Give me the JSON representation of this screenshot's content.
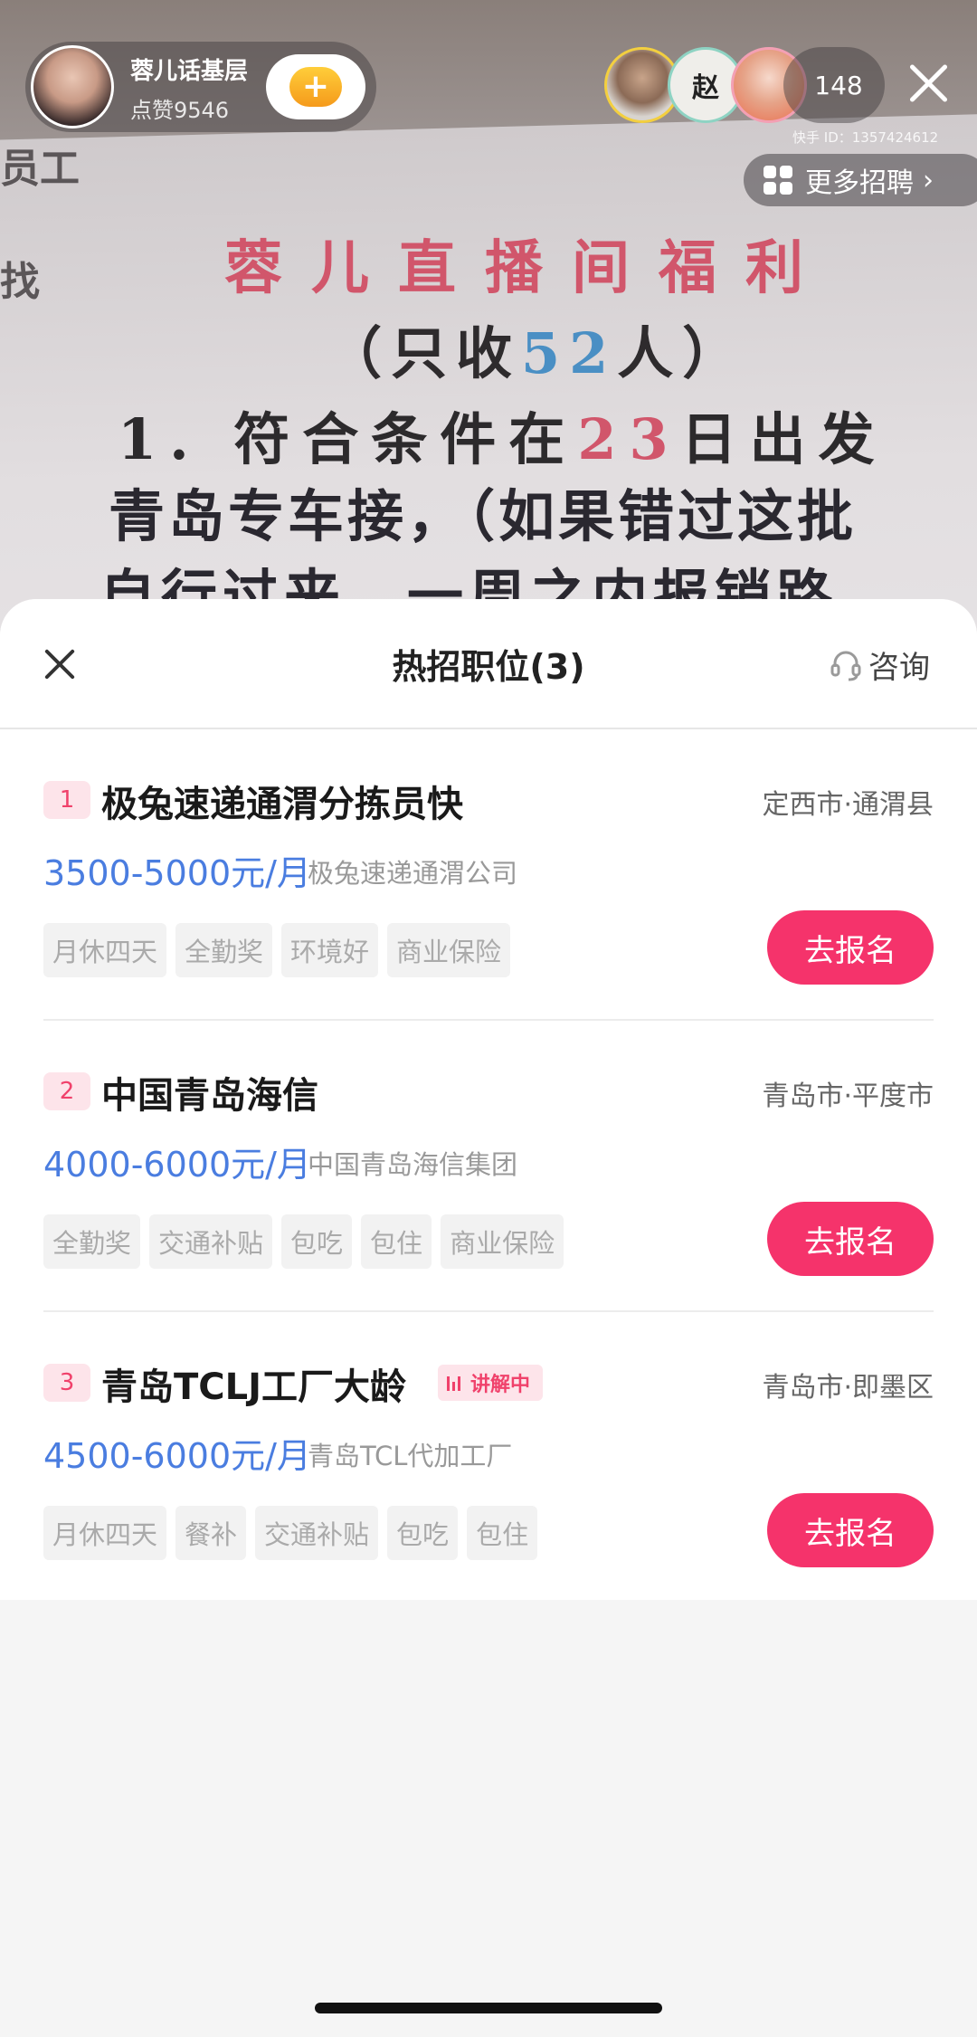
{
  "video": {
    "left_line1": "员工",
    "left_line2": "找",
    "title": "蓉儿直播间福利",
    "sub_prefix": "（只收",
    "sub_number": "52",
    "sub_suffix": "人）",
    "line1_prefix": "1. 符合条件在",
    "line1_number": "23",
    "line1_suffix": "日出发",
    "line2": "青岛专车接，（如果错过这批",
    "line3": "自行过来，一周之内报销路"
  },
  "host": {
    "name": "蓉儿话基层",
    "likes": "点赞9546",
    "follow_symbol": "+"
  },
  "viewers": {
    "avatar2_text": "赵",
    "count": "148"
  },
  "kuaishou_id": "快手 ID：1357424612",
  "more_jobs": {
    "label": "更多招聘",
    "chevron": "›"
  },
  "sheet": {
    "title": "热招职位(3)",
    "consult_label": "咨询"
  },
  "jobs": [
    {
      "index": "1",
      "title": "极兔速递通渭分拣员快",
      "location": "定西市·通渭县",
      "salary": "3500-5000元/月",
      "company": "极兔速递通渭公司",
      "tags": [
        "月休四天",
        "全勤奖",
        "环境好",
        "商业保险"
      ],
      "apply_label": "去报名"
    },
    {
      "index": "2",
      "title": "中国青岛海信",
      "location": "青岛市·平度市",
      "salary": "4000-6000元/月",
      "company": "中国青岛海信集团",
      "tags": [
        "全勤奖",
        "交通补贴",
        "包吃",
        "包住",
        "商业保险"
      ],
      "apply_label": "去报名"
    },
    {
      "index": "3",
      "title": "青岛TCLJ工厂大龄",
      "live_badge": "讲解中",
      "location": "青岛市·即墨区",
      "salary": "4500-6000元/月",
      "company": "青岛TCL代加工厂",
      "tags": [
        "月休四天",
        "餐补",
        "交通补贴",
        "包吃",
        "包住"
      ],
      "apply_label": "去报名"
    }
  ],
  "colors": {
    "accent": "#f5336b",
    "salary": "#4a7de0",
    "index_bg": "#fde4ea"
  }
}
